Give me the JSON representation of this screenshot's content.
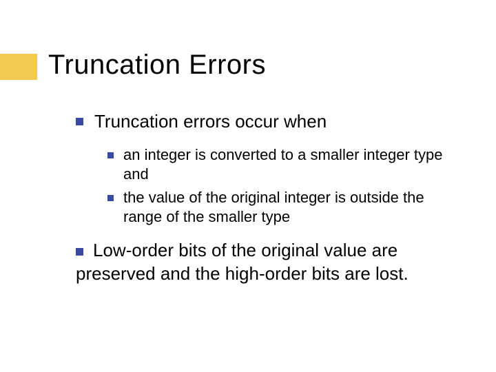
{
  "title": "Truncation Errors",
  "point1": "Truncation errors occur when",
  "sub1": "an integer is converted to a smaller integer type and",
  "sub2": "the value of the original integer is outside the range of the smaller type",
  "point2": "Low-order bits of the original value are preserved and the high-order bits are lost."
}
